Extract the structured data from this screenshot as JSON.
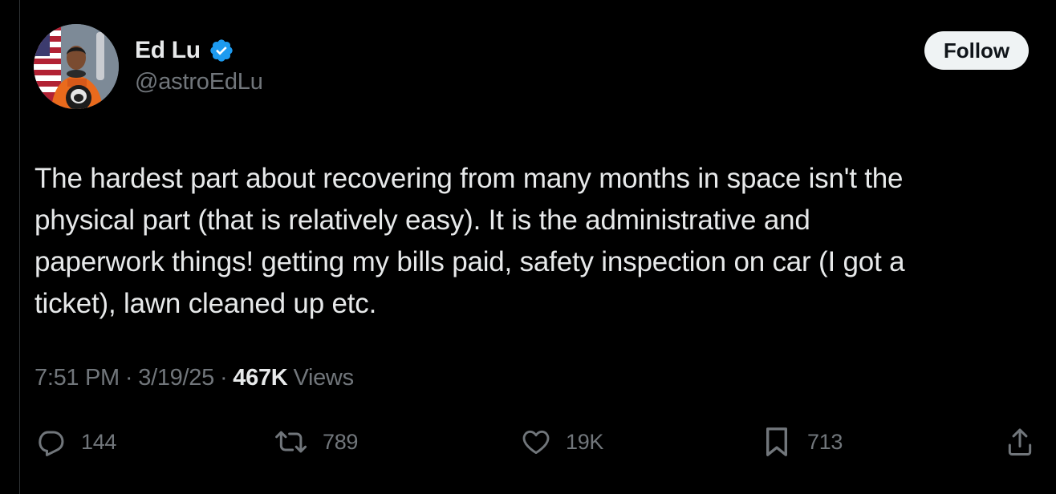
{
  "author": {
    "display_name": "Ed Lu",
    "handle": "@astroEdLu",
    "verified": true
  },
  "follow_button": {
    "label": "Follow"
  },
  "tweet": {
    "text": "The hardest part about recovering from many months in space isn't the\nphysical part (that is relatively easy).  It is the administrative and\npaperwork things!  getting my bills paid, safety inspection on car (I got a\nticket), lawn cleaned up etc."
  },
  "meta": {
    "time": "7:51 PM",
    "separator": "·",
    "date": "3/19/25",
    "views_count": "467K",
    "views_label": "Views"
  },
  "actions": {
    "replies": "144",
    "reposts": "789",
    "likes": "19K",
    "bookmarks": "713"
  },
  "icons": {
    "reply": "reply-icon",
    "repost": "repost-icon",
    "like": "heart-icon",
    "bookmark": "bookmark-icon",
    "share": "share-icon",
    "verified": "verified-badge-icon"
  },
  "colors": {
    "background": "#000000",
    "primary_text": "#e7e9ea",
    "secondary_text": "#71767b",
    "verified_blue": "#1d9bf0",
    "follow_button_bg": "#eff3f4"
  }
}
